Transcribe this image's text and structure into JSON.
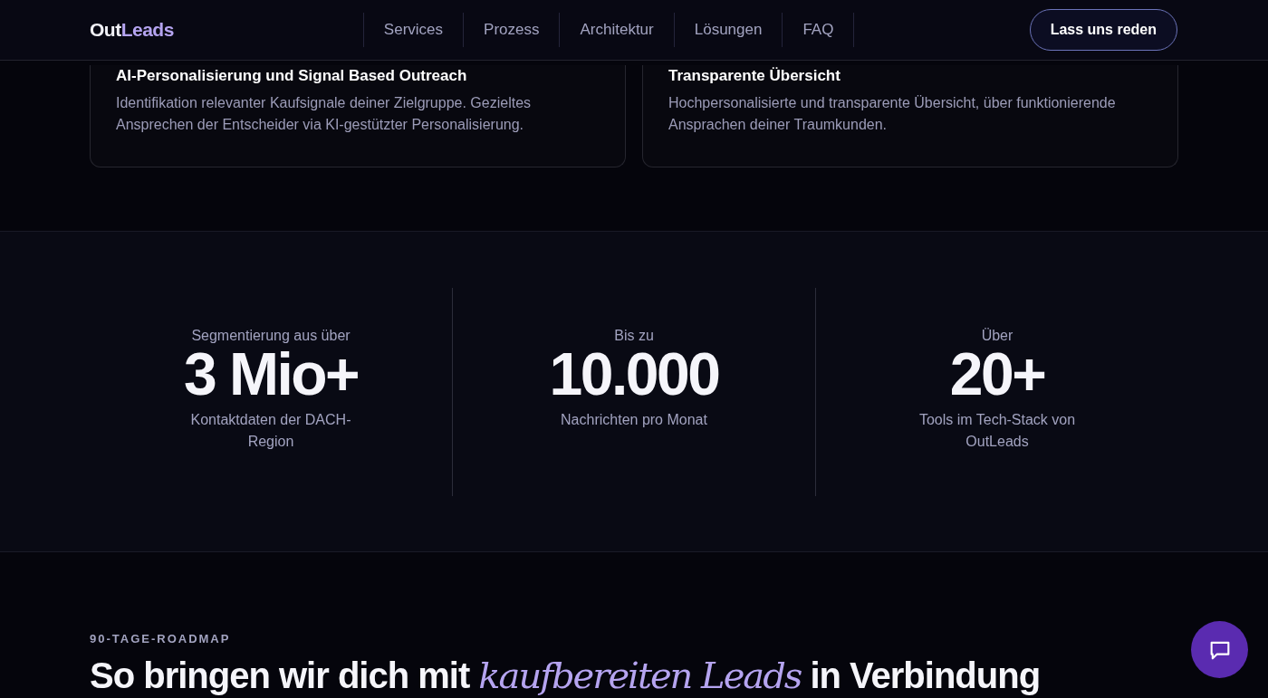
{
  "header": {
    "logo": {
      "primary": "Out",
      "accent": "Leads"
    },
    "nav": [
      {
        "label": "Services"
      },
      {
        "label": "Prozess"
      },
      {
        "label": "Architektur"
      },
      {
        "label": "Lösungen"
      },
      {
        "label": "FAQ"
      }
    ],
    "cta": "Lass uns reden"
  },
  "features": [
    {
      "title": "AI-Personalisierung und Signal Based Outreach",
      "text": "Identifikation relevanter Kaufsignale deiner Zielgruppe. Gezieltes Ansprechen der Entscheider via KI-gestützter Personalisierung."
    },
    {
      "title": "Transparente Übersicht",
      "text": "Hochpersonalisierte und transparente Übersicht, über funktionierende Ansprachen deiner Traumkunden."
    }
  ],
  "stats": [
    {
      "label": "Segmentierung aus über",
      "value": "3 Mio+",
      "caption": "Kontaktdaten der DACH-Region"
    },
    {
      "label": "Bis zu",
      "value": "10.000",
      "caption": "Nachrichten pro Monat"
    },
    {
      "label": "Über",
      "value": "20+",
      "caption": "Tools im Tech-Stack von OutLeads"
    }
  ],
  "roadmap": {
    "eyebrow": "90-TAGE-ROADMAP",
    "heading": "So bringen wir dich mit *kaufbereiten Leads* in Verbindung"
  }
}
